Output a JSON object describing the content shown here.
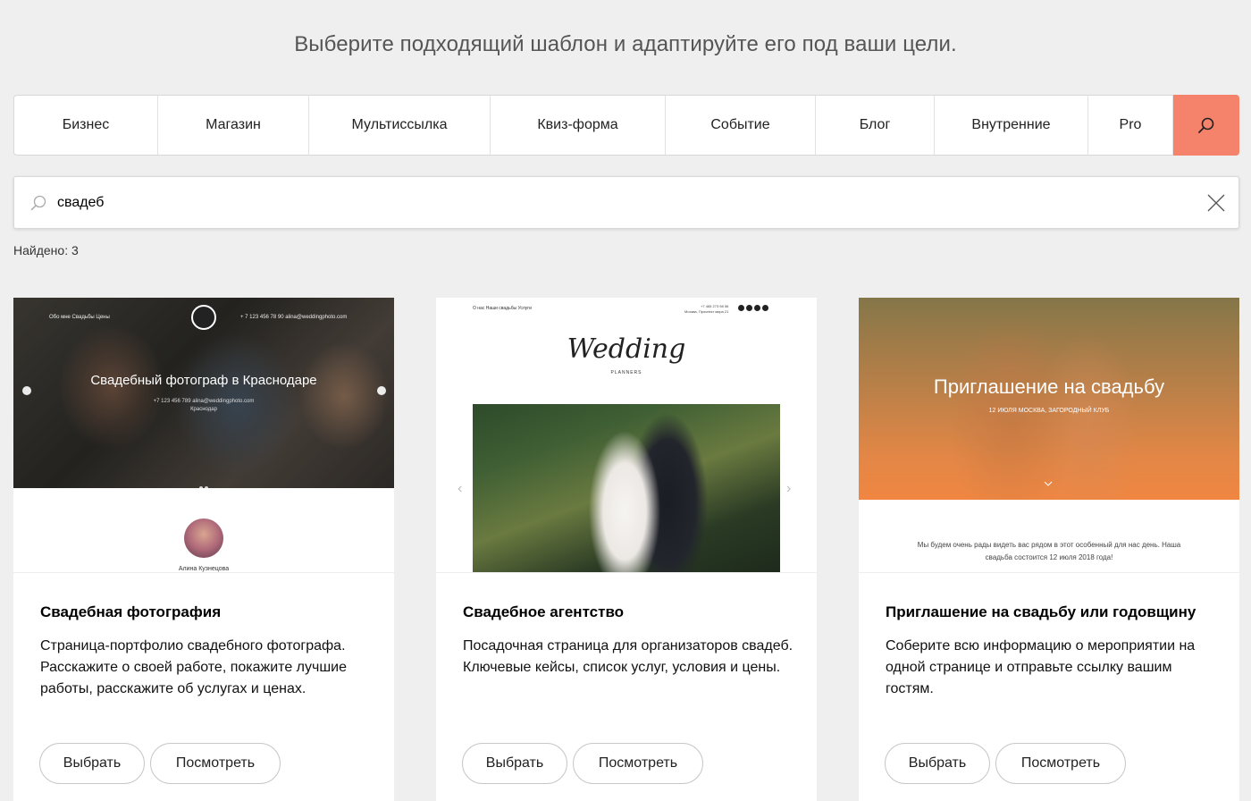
{
  "headline": "Выберите подходящий шаблон и адаптируйте его под ваши цели.",
  "tabs": [
    {
      "label": "Бизнес"
    },
    {
      "label": "Магазин"
    },
    {
      "label": "Мультиссылка"
    },
    {
      "label": "Квиз-форма"
    },
    {
      "label": "Событие"
    },
    {
      "label": "Блог"
    },
    {
      "label": "Внутренние"
    },
    {
      "label": "Pro"
    }
  ],
  "search": {
    "value": "свадеб",
    "icon": "search-icon",
    "clear_icon": "close-icon"
  },
  "found_label": "Найдено: 3",
  "colors": {
    "accent": "#f5826a",
    "background": "#efefef"
  },
  "cards": [
    {
      "title": "Свадебная фотография",
      "description": "Страница-портфолио свадебного фотографа. Расскажите о своей работе, покажите лучшие работы, расскажите об услугах и ценах.",
      "choose_label": "Выбрать",
      "view_label": "Посмотреть",
      "preview": {
        "nav_left": "Обо мне    Свадьбы    Цены",
        "nav_right": "+ 7 123 456 78 90    alina@weddingphoto.com",
        "heading": "Свадебный фотограф в Краснодаре",
        "sub1": "+7 123 456 789    alina@weddingphoto.com",
        "sub2": "Краснодар",
        "person_name": "Алина Кузнецова"
      }
    },
    {
      "title": "Свадебное агентство",
      "description": "Посадочная страница для организаторов свадеб. Ключевые кейсы, список услуг, условия и цены.",
      "choose_label": "Выбрать",
      "view_label": "Посмотреть",
      "preview": {
        "nav": "О нас     Наши свадьбы     Услуги",
        "phone": "+7 465 273 98 56",
        "address": "Москва, Проспект мира 21",
        "logo": "Wedding",
        "logo_sub": "PLANNERS",
        "prev": "‹",
        "next": "›"
      }
    },
    {
      "title": "Приглашение на свадьбу или годовщину",
      "description": "Соберите всю информацию о мероприятии на одной странице и отправьте ссылку вашим гостям.",
      "choose_label": "Выбрать",
      "view_label": "Посмотреть",
      "preview": {
        "heading": "Приглашение на свадьбу",
        "date": "12 ИЮЛЯ   МОСКВА, ЗАГОРОДНЫЙ КЛУБ",
        "text": "Мы будем очень рады видеть вас рядом в этот особенный для нас день. Наша свадьба состоится 12 июля 2018 года!"
      }
    }
  ]
}
